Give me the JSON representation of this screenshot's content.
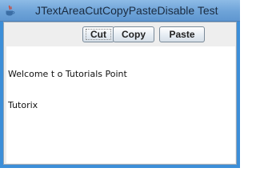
{
  "window": {
    "title": "JTextAreaCutCopyPasteDisable Test",
    "icon": "java-cup-icon"
  },
  "toolbar": {
    "cut_label": "Cut",
    "copy_label": "Copy",
    "paste_label": "Paste"
  },
  "textarea": {
    "lines": [
      "Welcome t o Tutorials Point",
      "Tutorix"
    ]
  },
  "colors": {
    "titlebar": "#6ea3d8",
    "window_frame": "#3c8ed8",
    "client_bg": "#eeeeee",
    "text_bg": "#ffffff"
  }
}
